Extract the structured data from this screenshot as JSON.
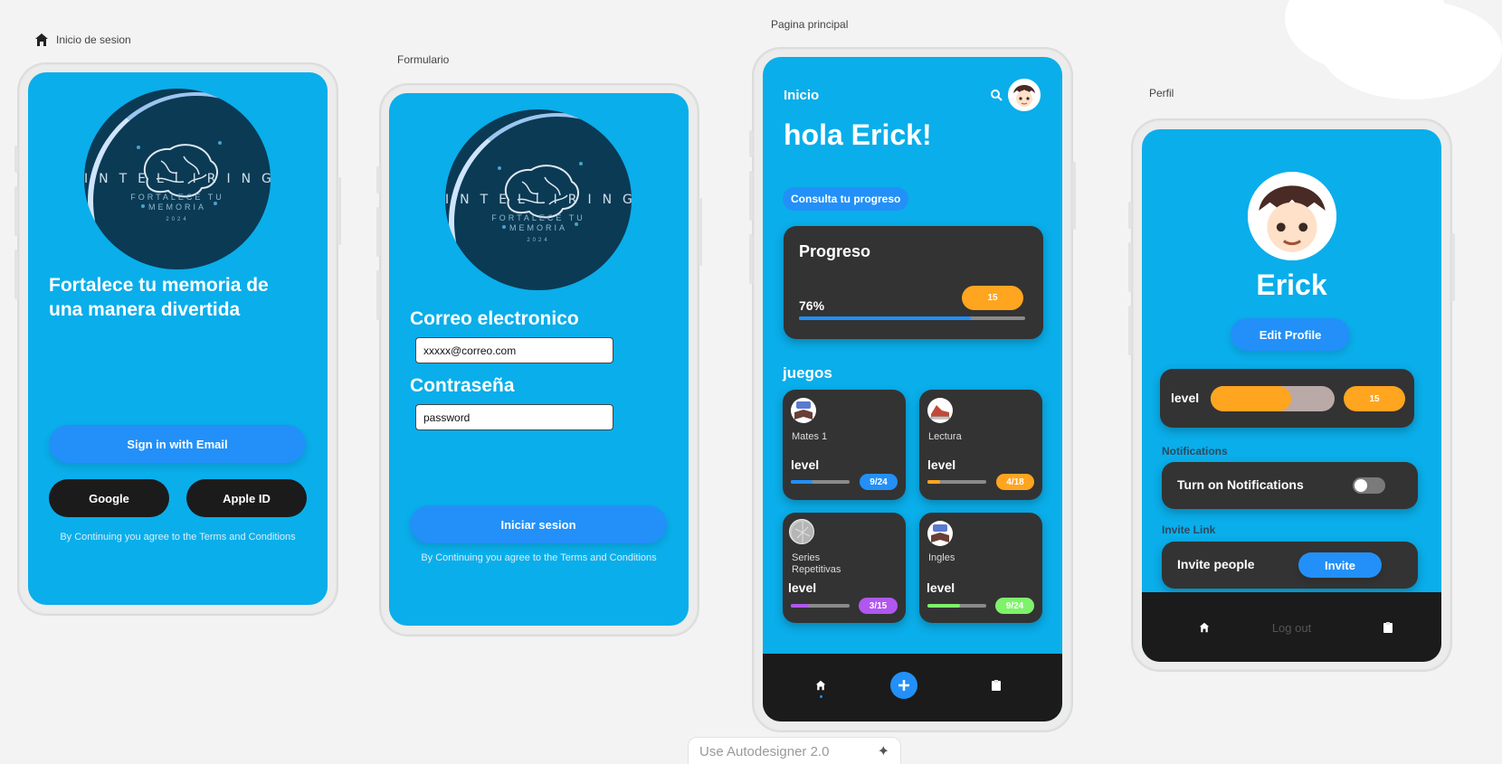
{
  "frames": {
    "login": {
      "label": "Inicio de sesion"
    },
    "form": {
      "label": "Formulario"
    },
    "home": {
      "label": "Pagina principal"
    },
    "profile": {
      "label": "Perfil"
    }
  },
  "logo": {
    "brand": "INTELLIRING",
    "subtitle_1": "FORTALECE TU",
    "subtitle_2": "MEMORIA",
    "year": "2024"
  },
  "login": {
    "headline": "Fortalece tu memoria de una manera divertida",
    "email_button": "Sign in with Email",
    "google_button": "Google",
    "apple_button": "Apple ID",
    "terms": "By Continuing you agree to the Terms and Conditions"
  },
  "form": {
    "email_label": "Correo electronico",
    "email_value": "xxxxx@correo.com",
    "password_label": "Contraseña",
    "password_value": "password",
    "submit_button": "Iniciar sesion",
    "terms": "By Continuing you agree to the Terms and Conditions"
  },
  "home": {
    "header_title": "Inicio",
    "greeting": "hola Erick!",
    "progress_chip": "Consulta tu progreso",
    "progress_card": {
      "title": "Progreso",
      "percent_label": "76%",
      "progress": 0.76,
      "level_badge": "15"
    },
    "games_title": "juegos",
    "games": [
      {
        "name": "Mates 1",
        "level_label": "level",
        "count": "9/24",
        "progress": 0.375,
        "color": "#2290f8"
      },
      {
        "name": "Lectura",
        "level_label": "level",
        "count": "4/18",
        "progress": 0.22,
        "color": "#ffa51f"
      },
      {
        "name": "Series Repetitivas",
        "level_label": "level",
        "count": "3/15",
        "progress": 0.3,
        "color": "#b057f0"
      },
      {
        "name": "Ingles",
        "level_label": "level",
        "count": "9/24",
        "progress": 0.55,
        "color": "#7ef26a"
      }
    ]
  },
  "profile": {
    "name": "Erick",
    "edit_button": "Edit Profile",
    "level_label": "level",
    "level_progress": 0.65,
    "level_badge": "15",
    "notifications_section": "Notifications",
    "notifications_label": "Turn on Notifications",
    "invite_section": "Invite Link",
    "invite_label": "Invite people",
    "invite_button": "Invite",
    "logout": "Log out"
  },
  "autodesigner": {
    "label": "Use Autodesigner 2.0"
  },
  "colors": {
    "screen_bg": "#0aaeea",
    "primary_blue": "#2290f8",
    "card_dark": "#333333",
    "accent_orange": "#ffa51f"
  }
}
